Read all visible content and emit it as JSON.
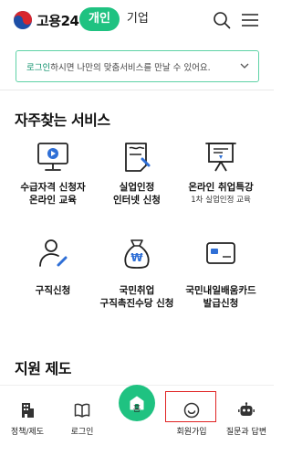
{
  "header": {
    "logo_text": "고용24",
    "tab_active": "개인",
    "tab_inactive": "기업"
  },
  "banner": {
    "link_text": "로그인",
    "text": "하시면 나만의 맞춤서비스를 만날 수 있어요."
  },
  "sections": {
    "frequent_title": "자주찾는 서비스",
    "support_title": "지원 제도"
  },
  "services": [
    {
      "icon": "monitor-play-icon",
      "line1": "수급자격 신청자",
      "line2": "온라인 교육",
      "sub": ""
    },
    {
      "icon": "document-edit-icon",
      "line1": "실업인정",
      "line2": "인터넷 신청",
      "sub": ""
    },
    {
      "icon": "presentation-board-icon",
      "line1": "온라인 취업특강",
      "line2": "",
      "sub": "1차 실업인정 교육"
    },
    {
      "icon": "person-edit-icon",
      "line1": "구직신청",
      "line2": "",
      "sub": ""
    },
    {
      "icon": "money-bag-icon",
      "line1": "국민취업",
      "line2": "구직촉진수당 신청",
      "sub": ""
    },
    {
      "icon": "card-icon",
      "line1": "국민내일배움카드",
      "line2": "발급신청",
      "sub": ""
    }
  ],
  "bottom_nav": [
    {
      "icon": "building-icon",
      "label": "정책/제도"
    },
    {
      "icon": "book-icon",
      "label": "로그인"
    },
    {
      "icon": "home-icon",
      "label": "홈"
    },
    {
      "icon": "smile-icon",
      "label": "회원가입"
    },
    {
      "icon": "robot-icon",
      "label": "질문과 답변"
    }
  ],
  "colors": {
    "brand_green": "#1fc281",
    "highlight_red": "#e02424"
  }
}
